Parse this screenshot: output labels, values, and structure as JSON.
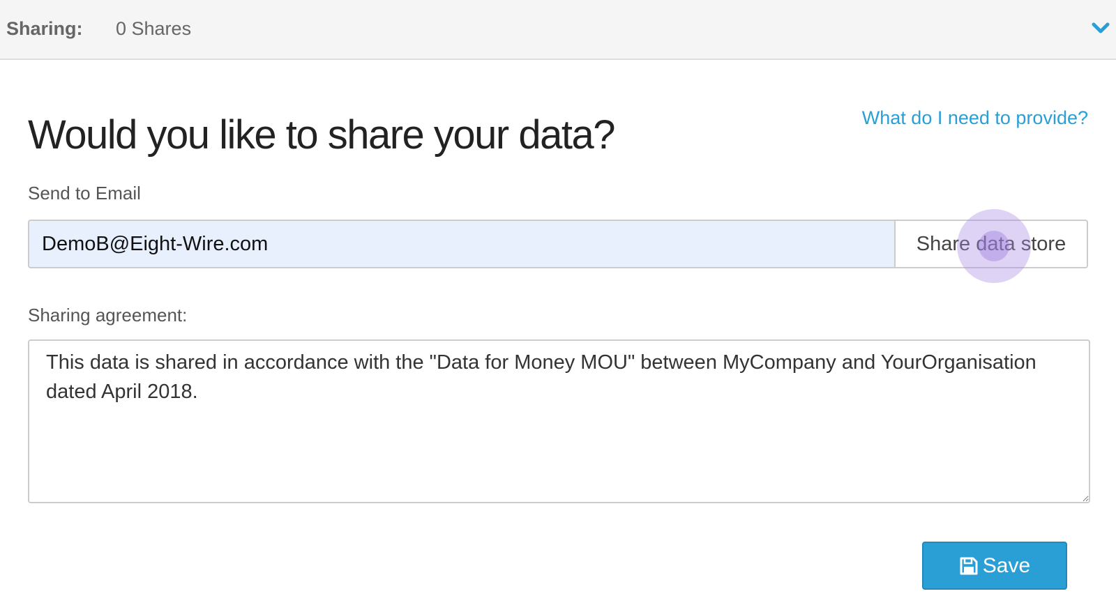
{
  "header": {
    "sharing_label": "Sharing:",
    "shares_count": "0 Shares",
    "toggle_icon": "chevron-down-icon"
  },
  "main": {
    "help_link": "What do I need to provide?",
    "title": "Would you like to share your data?",
    "email": {
      "label": "Send to Email",
      "value": "DemoB@Eight-Wire.com"
    },
    "share_button_label": "Share data store",
    "agreement": {
      "label": "Sharing agreement:",
      "value": "This data is shared in accordance with the \"Data for Money MOU\" between MyCompany and YourOrganisation dated April 2018."
    },
    "save": {
      "label": "Save",
      "icon": "floppy-disk-icon"
    }
  },
  "colors": {
    "accent": "#2a9fd6",
    "input_autofill": "#e8f0fe",
    "header_bg": "#f5f5f5"
  }
}
